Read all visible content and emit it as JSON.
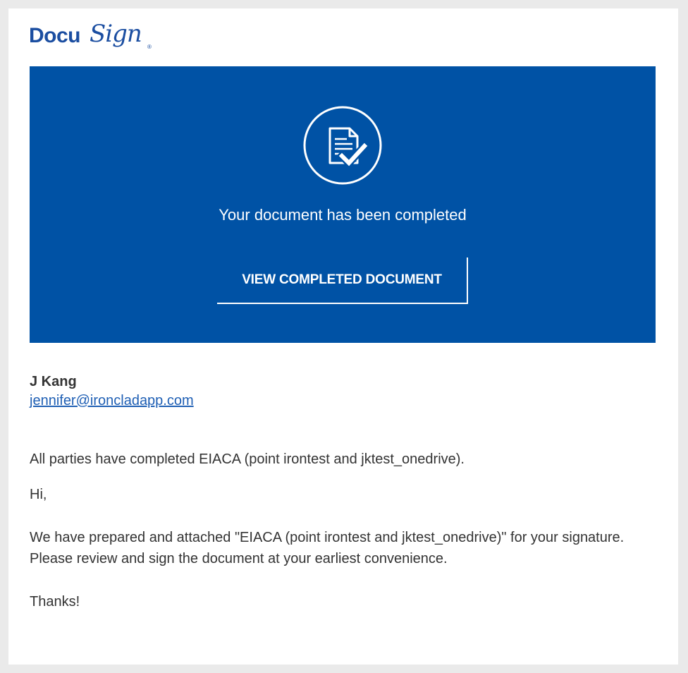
{
  "logo": {
    "docu": "Docu",
    "sign": "Sign",
    "reg": "®"
  },
  "banner": {
    "icon": "document-check-icon",
    "title": "Your document has been completed",
    "button_label": "VIEW COMPLETED DOCUMENT",
    "background_color": "#0052a5"
  },
  "sender": {
    "name": "J Kang",
    "email": "jennifer@ironcladapp.com"
  },
  "body": {
    "summary": "All parties have completed EIACA (point irontest and jktest_onedrive).",
    "greeting": "Hi,",
    "message": "We have prepared and attached \"EIACA (point irontest and jktest_onedrive)\" for your signature. Please review and sign the document at your earliest convenience.",
    "closing": "Thanks!"
  },
  "colors": {
    "brand": "#1b4ea1",
    "link": "#1f5fb4"
  }
}
